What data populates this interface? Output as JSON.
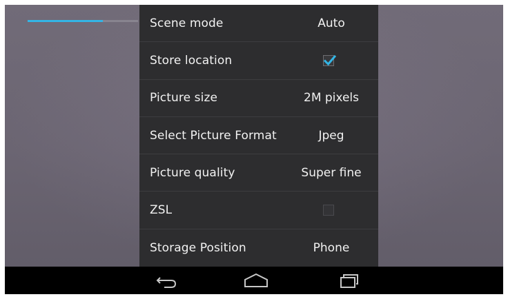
{
  "camera": {
    "zoom_progress": 0.68
  },
  "settings": {
    "rows": [
      {
        "label": "Scene mode",
        "value": "Auto",
        "type": "text"
      },
      {
        "label": "Store location",
        "value": "",
        "type": "checkbox",
        "checked": true
      },
      {
        "label": "Picture size",
        "value": "2M pixels",
        "type": "text"
      },
      {
        "label": "Select Picture Format",
        "value": "Jpeg",
        "type": "text"
      },
      {
        "label": "Picture quality",
        "value": "Super fine",
        "type": "text"
      },
      {
        "label": "ZSL",
        "value": "",
        "type": "checkbox",
        "checked": false
      },
      {
        "label": "Storage Position",
        "value": "Phone",
        "type": "text"
      }
    ]
  },
  "navigation": {
    "buttons": [
      {
        "icon": "back-icon"
      },
      {
        "icon": "home-icon"
      },
      {
        "icon": "recent-apps-icon"
      }
    ]
  },
  "colors": {
    "accent": "#33b5e5",
    "panel": "#2d2d2f",
    "navbar": "#000000"
  }
}
